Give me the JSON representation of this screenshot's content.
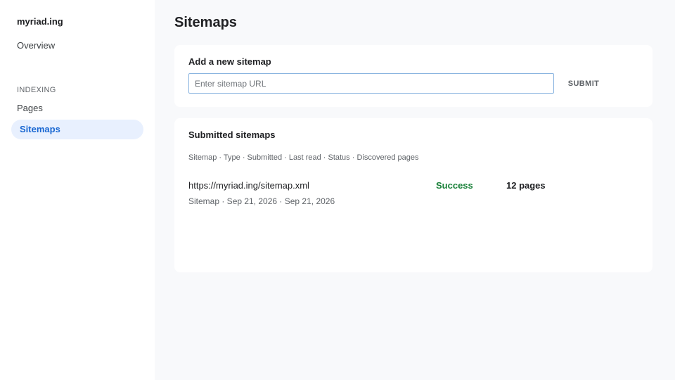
{
  "sidebar": {
    "brand": "myriad.ing",
    "overview": "Overview",
    "section": "INDEXING",
    "items": [
      {
        "label": "Pages"
      },
      {
        "label": "Sitemaps",
        "active": true
      }
    ]
  },
  "main": {
    "title": "Sitemaps",
    "add": {
      "title": "Add a new sitemap",
      "input_value": "",
      "placeholder": "Enter sitemap URL",
      "submit_label": "SUBMIT"
    },
    "submitted": {
      "title": "Submitted sitemaps",
      "columns": "Sitemap · Type · Submitted · Last read · Status · Discovered pages",
      "rows": [
        {
          "url": "https://myriad.ing/sitemap.xml",
          "meta": "Sitemap · Sep 21, 2026 · Sep 21, 2026",
          "status": "Success",
          "pages": "12 pages"
        }
      ]
    }
  },
  "colors": {
    "accent": "#1967d2",
    "active_bg": "#e8f0fe",
    "success": "#188038",
    "background": "#f8f9fb"
  }
}
